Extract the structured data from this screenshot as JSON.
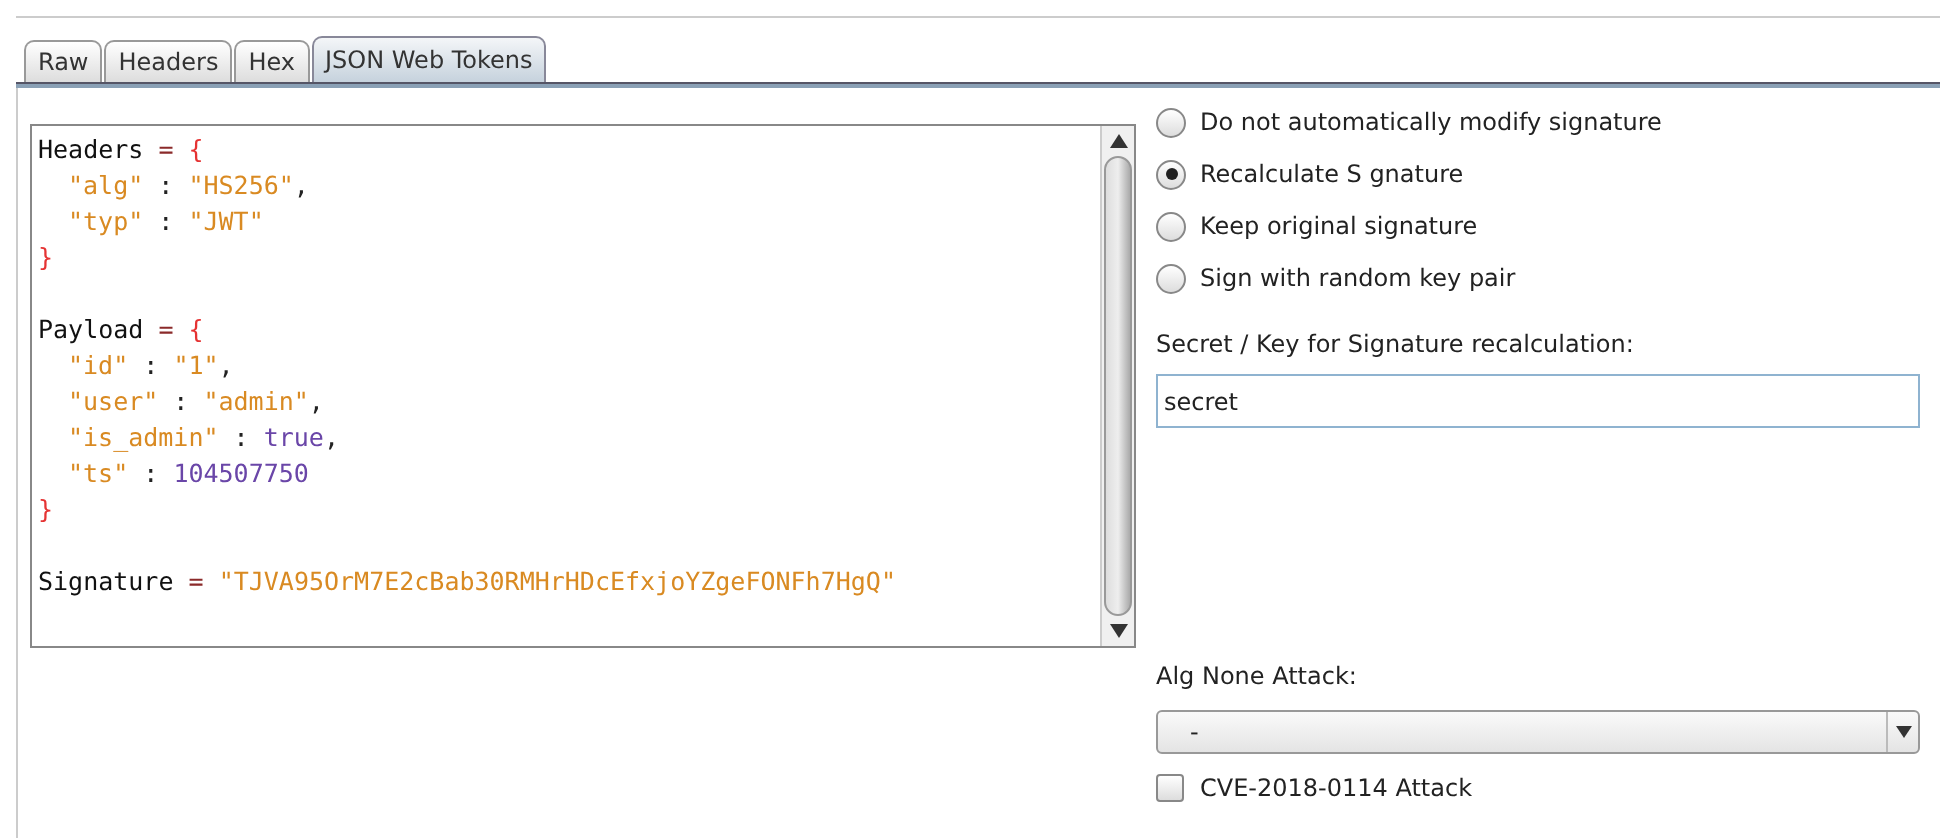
{
  "tabs": [
    {
      "label": "Raw",
      "selected": false
    },
    {
      "label": "Headers",
      "selected": false
    },
    {
      "label": "Hex",
      "selected": false
    },
    {
      "label": "JSON Web Tokens",
      "selected": true
    }
  ],
  "editor": {
    "blocks": [
      {
        "head": [
          {
            "kind": "name",
            "text": "Headers"
          },
          {
            "kind": "op",
            "text": " = "
          },
          {
            "kind": "brace",
            "text": "{"
          }
        ],
        "entries": [
          [
            {
              "kind": "string",
              "text": "\"alg\""
            },
            {
              "kind": "punct",
              "text": " : "
            },
            {
              "kind": "string",
              "text": "\"HS256\""
            },
            {
              "kind": "punct",
              "text": ","
            }
          ],
          [
            {
              "kind": "string",
              "text": "\"typ\""
            },
            {
              "kind": "punct",
              "text": " : "
            },
            {
              "kind": "string",
              "text": "\"JWT\""
            }
          ]
        ],
        "close": [
          {
            "kind": "brace",
            "text": "}"
          }
        ]
      },
      {
        "head": [
          {
            "kind": "name",
            "text": "Payload"
          },
          {
            "kind": "op",
            "text": " = "
          },
          {
            "kind": "brace",
            "text": "{"
          }
        ],
        "entries": [
          [
            {
              "kind": "string",
              "text": "\"id\""
            },
            {
              "kind": "punct",
              "text": " : "
            },
            {
              "kind": "string",
              "text": "\"1\""
            },
            {
              "kind": "punct",
              "text": ","
            }
          ],
          [
            {
              "kind": "string",
              "text": "\"user\""
            },
            {
              "kind": "punct",
              "text": " : "
            },
            {
              "kind": "string",
              "text": "\"admin\""
            },
            {
              "kind": "punct",
              "text": ","
            }
          ],
          [
            {
              "kind": "string",
              "text": "\"is_admin\""
            },
            {
              "kind": "punct",
              "text": " : "
            },
            {
              "kind": "literal",
              "text": "true"
            },
            {
              "kind": "punct",
              "text": ","
            }
          ],
          [
            {
              "kind": "string",
              "text": "\"ts\""
            },
            {
              "kind": "punct",
              "text": " : "
            },
            {
              "kind": "literal",
              "text": "104507750"
            }
          ]
        ],
        "close": [
          {
            "kind": "brace",
            "text": "}"
          }
        ]
      },
      {
        "head": [
          {
            "kind": "name",
            "text": "Signature"
          },
          {
            "kind": "op",
            "text": " = "
          },
          {
            "kind": "string",
            "text": "\"TJVA95OrM7E2cBab30RMHrHDcEfxjoYZgeFONFh7HgQ\""
          }
        ]
      }
    ]
  },
  "signature_options": [
    {
      "label": "Do not automatically modify signature",
      "selected": false
    },
    {
      "label": "Recalculate S gnature",
      "selected": true
    },
    {
      "label": "Keep original signature",
      "selected": false
    },
    {
      "label": "Sign with random key pair",
      "selected": false
    }
  ],
  "secret": {
    "label": "Secret / Key for Signature recalculation:",
    "value": "secret"
  },
  "alg_none": {
    "label": "Alg None Attack:",
    "value": "-"
  },
  "cve_attack": {
    "label": "CVE-2018-0114 Attack",
    "checked": false
  }
}
